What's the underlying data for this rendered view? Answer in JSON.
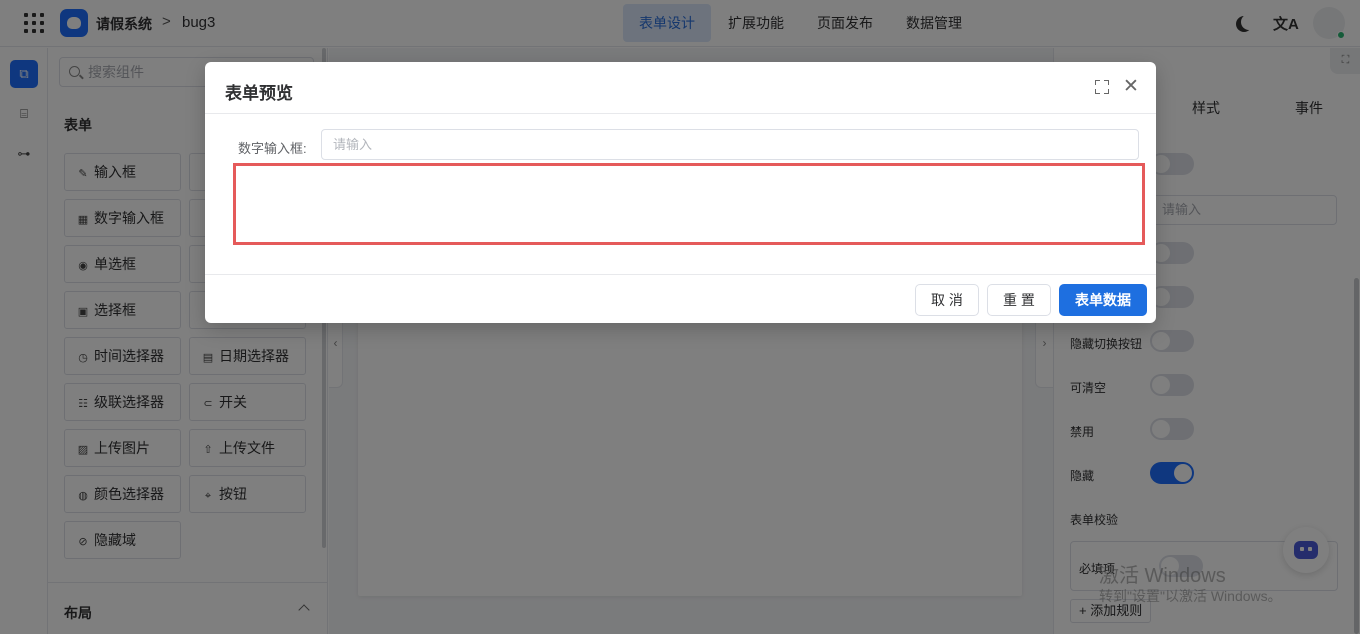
{
  "header": {
    "app_title": "请假系统",
    "breadcrumb_sep": ">",
    "breadcrumb_item": "bug3",
    "tabs": [
      {
        "label": "表单设计",
        "active": true
      },
      {
        "label": "扩展功能",
        "active": false
      },
      {
        "label": "页面发布",
        "active": false
      },
      {
        "label": "数据管理",
        "active": false
      }
    ],
    "translate_glyph": "文A",
    "status_color": "#2bb673"
  },
  "components": {
    "search_placeholder": "搜索组件",
    "section_form": "表单",
    "section_layout": "布局",
    "items": [
      {
        "label": "输入框",
        "icon": "✎"
      },
      {
        "label": "数字输入框",
        "icon": "▦"
      },
      {
        "label": "单选框",
        "icon": "◉"
      },
      {
        "label": "选择框",
        "icon": "▣"
      },
      {
        "label": "时间选择器",
        "icon": "◷"
      },
      {
        "label": "日期选择器",
        "icon": "▤"
      },
      {
        "label": "级联选择器",
        "icon": "☷"
      },
      {
        "label": "开关",
        "icon": "⊂"
      },
      {
        "label": "上传图片",
        "icon": "▨"
      },
      {
        "label": "上传文件",
        "icon": "⇧"
      },
      {
        "label": "颜色选择器",
        "icon": "◍"
      },
      {
        "label": "按钮",
        "icon": "⌖"
      },
      {
        "label": "隐藏域",
        "icon": "⊘"
      }
    ]
  },
  "properties": {
    "tabs": [
      "样式",
      "事件"
    ],
    "input_placeholder": "请输入",
    "hide_toggle_label": "隐藏切换按钮",
    "clearable_label": "可清空",
    "disabled_label": "禁用",
    "hidden_label": "隐藏",
    "validation_label": "表单校验",
    "required_label": "必填项",
    "add_rule": "+ 添加规则",
    "watermark_line1": "激活 Windows",
    "watermark_line2": "转到\"设置\"以激活 Windows。"
  },
  "modal": {
    "title": "表单预览",
    "field_label": "数字输入框:",
    "field_placeholder": "请输入",
    "cancel": "取 消",
    "reset": "重 置",
    "submit": "表单数据",
    "highlight_color": "#e55a5a"
  }
}
